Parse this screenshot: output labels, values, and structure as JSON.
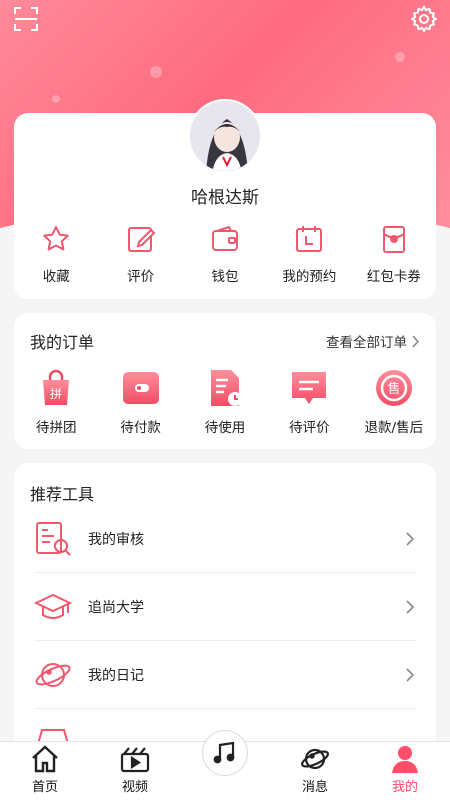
{
  "colors": {
    "accent": "#ff6b80",
    "accent_dark": "#ff4d6a",
    "background": "#f5f5f5"
  },
  "header": {
    "scan_icon": "scan-icon",
    "settings_icon": "gear-icon"
  },
  "profile": {
    "username": "哈根达斯",
    "avatar_icon": "avatar",
    "quick_actions": [
      {
        "label": "收藏",
        "icon": "star-icon"
      },
      {
        "label": "评价",
        "icon": "edit-icon"
      },
      {
        "label": "钱包",
        "icon": "wallet-icon"
      },
      {
        "label": "我的预约",
        "icon": "calendar-icon"
      },
      {
        "label": "红包卡券",
        "icon": "red-packet-icon"
      }
    ]
  },
  "orders": {
    "title": "我的订单",
    "see_all": "查看全部订单",
    "items": [
      {
        "label": "待拼团",
        "icon": "group-buy-icon",
        "badge": "拼"
      },
      {
        "label": "待付款",
        "icon": "payment-icon"
      },
      {
        "label": "待使用",
        "icon": "to-use-icon"
      },
      {
        "label": "待评价",
        "icon": "review-icon"
      },
      {
        "label": "退款/售后",
        "icon": "refund-icon",
        "badge": "售"
      }
    ]
  },
  "tools": {
    "title": "推荐工具",
    "items": [
      {
        "label": "我的审核",
        "icon": "audit-icon"
      },
      {
        "label": "追尚大学",
        "icon": "graduation-cap-icon"
      },
      {
        "label": "我的日记",
        "icon": "planet-icon"
      },
      {
        "label": "",
        "icon": "partial-icon"
      }
    ]
  },
  "bottom_nav": {
    "items": [
      {
        "label": "首页",
        "icon": "home-icon"
      },
      {
        "label": "视频",
        "icon": "video-icon"
      },
      {
        "label": "",
        "icon": "music-note-icon"
      },
      {
        "label": "消息",
        "icon": "planet-icon"
      },
      {
        "label": "我的",
        "icon": "person-icon",
        "active": true
      }
    ]
  }
}
